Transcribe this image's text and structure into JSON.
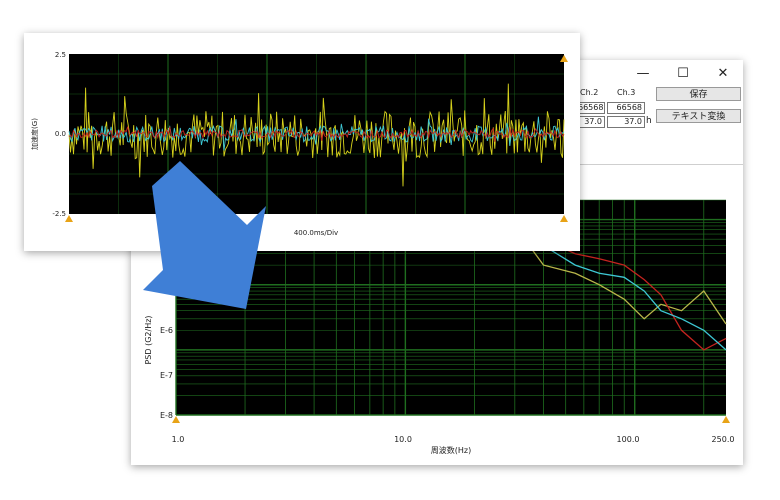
{
  "psd_window": {
    "controls": {
      "minimize_icon": "—",
      "maximize_icon": "☐",
      "close_icon": "✕"
    },
    "channels": [
      {
        "label": "Ch.2",
        "value1": "66568",
        "value2": "37.0"
      },
      {
        "label": "Ch.3",
        "value1": "66568",
        "value2": "37.0"
      }
    ],
    "unit_label": "h",
    "save_button": "保存",
    "text_convert_button": "テキスト変換",
    "chart": {
      "ylabel": "PSD (G2/Hz)",
      "xlabel": "周波数(Hz)",
      "x_ticks": [
        "1.0",
        "10.0",
        "100.0",
        "250.0"
      ],
      "y_ticks": [
        "E-5",
        "E-6",
        "E-7",
        "E-8"
      ]
    }
  },
  "wave_window": {
    "chart": {
      "ylabel": "加速度(G)",
      "xlabel": "400.0ms/Div",
      "y_ticks": [
        "2.5",
        "0.0",
        "-2.5"
      ]
    }
  },
  "arrow": {
    "color": "#3f7fd6",
    "icon": "arrow-down-right-icon"
  },
  "colors": {
    "plot_bg": "#000000",
    "grid": "#1f6e1f",
    "yellow": "#d7d21c",
    "cyan": "#3ec7d4",
    "red": "#c4231f",
    "psd_yellow": "#b9b64a"
  },
  "chart_data": [
    {
      "type": "line",
      "title": "",
      "xlabel": "周波数(Hz)",
      "ylabel": "PSD (G2/Hz)",
      "xscale": "log",
      "yscale": "log",
      "xlim": [
        1.0,
        250.0
      ],
      "ylim": [
        1e-08,
        2e-05
      ],
      "grid": true,
      "series": [
        {
          "color": "#b9b64a",
          "x": [
            1,
            2,
            3,
            4.5,
            6,
            7,
            8,
            10,
            13,
            16,
            20,
            25,
            30,
            40,
            55,
            70,
            90,
            110,
            130,
            160,
            200,
            250
          ],
          "y": [
            2e-05,
            1.9e-05,
            1.5e-05,
            1.2e-05,
            1.6e-05,
            2e-05,
            2e-05,
            1.5e-05,
            1.2e-05,
            1.6e-05,
            2e-05,
            1.8e-05,
            8e-06,
            2e-06,
            1.5e-06,
            1e-06,
            6e-07,
            3e-07,
            5e-07,
            4e-07,
            8e-07,
            2.5e-07
          ]
        },
        {
          "color": "#c4231f",
          "x": [
            10,
            13,
            16,
            20,
            25,
            30,
            40,
            55,
            70,
            90,
            110,
            130,
            160,
            200,
            250
          ],
          "y": [
            2e-05,
            1.8e-05,
            1.3e-05,
            1e-05,
            1.2e-05,
            1.4e-05,
            5e-06,
            3e-06,
            2.5e-06,
            2e-06,
            1.2e-06,
            7e-07,
            2e-07,
            1e-07,
            1.5e-07
          ]
        },
        {
          "color": "#3ec7d4",
          "x": [
            25,
            30,
            40,
            55,
            70,
            90,
            110,
            130,
            160,
            200,
            250
          ],
          "y": [
            1.8e-05,
            1.5e-05,
            4e-06,
            2e-06,
            1.5e-06,
            1.3e-06,
            8e-07,
            4e-07,
            3e-07,
            2e-07,
            1e-07
          ]
        }
      ]
    },
    {
      "type": "line",
      "title": "",
      "xlabel": "400.0ms/Div",
      "ylabel": "加速度(G)",
      "ylim": [
        -2.5,
        2.5
      ],
      "grid": true,
      "series": [
        {
          "color": "#d7d21c",
          "amplitude": 0.75,
          "samples": 330
        },
        {
          "color": "#3ec7d4",
          "amplitude": 0.25,
          "samples": 330
        },
        {
          "color": "#c4231f",
          "amplitude": 0.12,
          "samples": 330
        }
      ]
    }
  ]
}
